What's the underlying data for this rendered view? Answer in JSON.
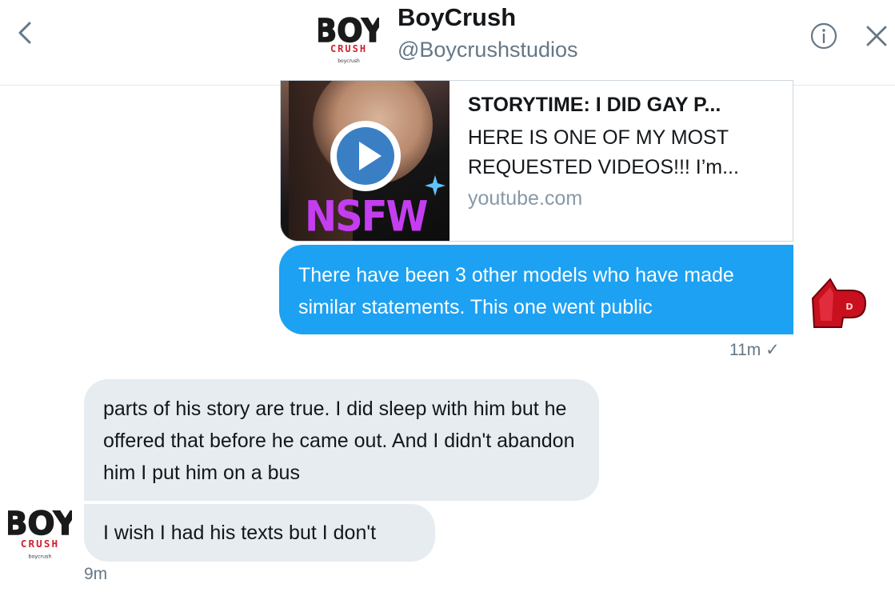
{
  "header": {
    "name": "BoyCrush",
    "handle": "@Boycrushstudios",
    "logo": {
      "line1": "BOY",
      "line2": "CRUSH",
      "line3": "boycrush"
    },
    "icons": [
      "back-chevron-icon",
      "info-icon",
      "close-icon"
    ]
  },
  "link_card": {
    "title": "STORYTIME: I DID GAY P...",
    "description": "HERE IS ONE OF MY MOST REQUESTED VIDEOS!!! I’m...",
    "domain": "youtube.com",
    "thumbnail_overlay_text": "NSFW"
  },
  "messages": {
    "outgoing": [
      {
        "text": "There have been 3 other models who have made similar statements. This one went public"
      }
    ],
    "outgoing_meta": "11m ✓",
    "incoming": [
      {
        "text": "parts of his story are true. I did sleep with him but he offered that before he came out. And I didn't abandon him I put him on a bus"
      },
      {
        "text": "I wish I had his texts but I don't"
      }
    ],
    "incoming_meta": "9m"
  },
  "colors": {
    "accent": "#1da1f2",
    "incoming_bubble": "#e6ecf0",
    "muted": "#657786",
    "logo_red": "#d0202e",
    "nsfw_purple": "#c43df0"
  }
}
